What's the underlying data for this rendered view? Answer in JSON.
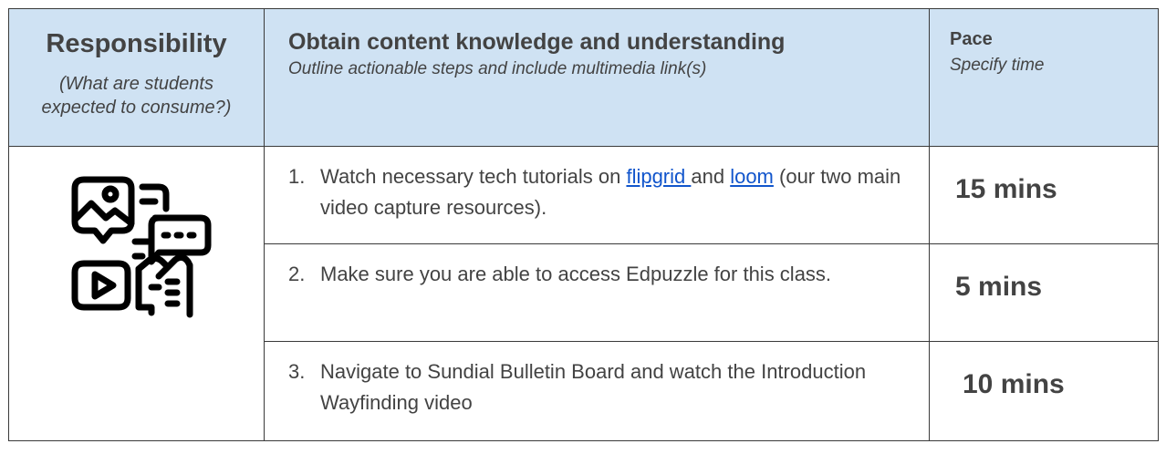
{
  "header": {
    "responsibility_title": "Responsibility",
    "responsibility_subtitle_1": "(What are students",
    "responsibility_subtitle_2": "expected to consume?)",
    "task_title": "Obtain content knowledge and understanding",
    "task_subtitle": "Outline actionable steps and include multimedia link(s)",
    "pace_title": "Pace",
    "pace_subtitle": "Specify time"
  },
  "icon": "multimedia-content-icon",
  "steps": [
    {
      "number": "1.",
      "text_before": "Watch necessary tech tutorials on ",
      "link1": "flipgrid ",
      "text_middle": "and ",
      "link2": "loom",
      "text_after": " (our two main video capture resources).",
      "pace": "15 mins"
    },
    {
      "number": "2.",
      "text": "Make sure you are able to access Edpuzzle for this class.",
      "pace": "5 mins"
    },
    {
      "number": "3.",
      "text": "Navigate to Sundial Bulletin Board and watch the Introduction Wayfinding video",
      "pace": "10 mins"
    }
  ],
  "colors": {
    "header_bg": "#cfe2f3",
    "text": "#434343",
    "link": "#1155cc",
    "border": "#3a3a3a"
  }
}
